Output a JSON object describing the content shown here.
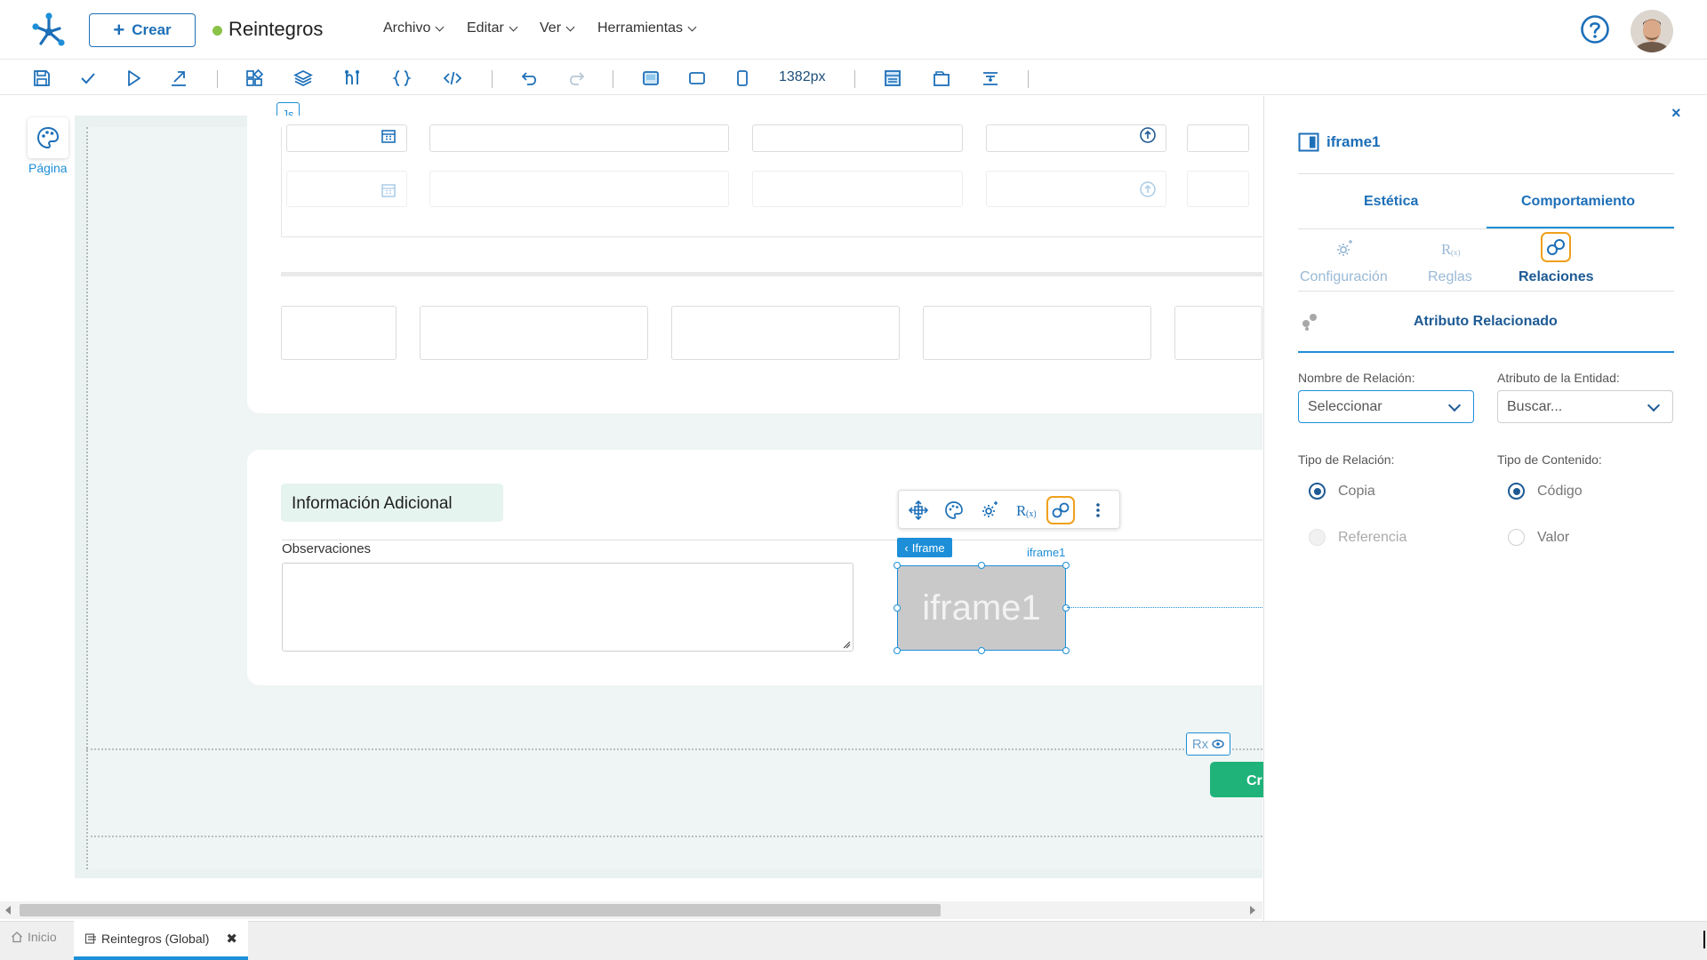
{
  "header": {
    "create_label": "Crear",
    "app_title": "Reintegros",
    "status_color": "#8bc34a",
    "menu": [
      {
        "label": "Archivo"
      },
      {
        "label": "Editar"
      },
      {
        "label": "Ver"
      },
      {
        "label": "Herramientas"
      }
    ],
    "help_icon": "help-circle-icon",
    "avatar": "user-avatar"
  },
  "toolbar": {
    "icons": [
      "save-icon",
      "check-icon",
      "play-icon",
      "publish-icon",
      "components-icon",
      "layers-icon",
      "flow-icon",
      "braces-icon",
      "code-icon",
      "undo-icon",
      "redo-icon",
      "desktop-icon",
      "tablet-icon",
      "mobile-icon",
      "layout-icon",
      "frame-icon",
      "align-icon"
    ],
    "width_readout": "1382px"
  },
  "canvas": {
    "pagina_label": "Página",
    "js_badge": "Js",
    "section_title": "Información Adicional",
    "observaciones_label": "Observaciones",
    "iframe_tag": "Iframe",
    "iframe_name": "iframe1",
    "iframe_placeholder": "iframe1",
    "rx_badge": "Rx",
    "green_button_label": "Cr"
  },
  "bottom_tabs": {
    "home_label": "Inicio",
    "active_tab_label": "Reintegros (Global)"
  },
  "panel": {
    "title": "iframe1",
    "tabs": [
      {
        "label": "Estética"
      },
      {
        "label": "Comportamiento"
      }
    ],
    "subtabs": [
      {
        "label": "Configuración"
      },
      {
        "label": "Reglas"
      },
      {
        "label": "Relaciones"
      }
    ],
    "section_title": "Atributo Relacionado",
    "nombre_relacion_label": "Nombre de Relación:",
    "nombre_relacion_value": "Seleccionar",
    "atributo_entidad_label": "Atributo de la Entidad:",
    "atributo_entidad_placeholder": "Buscar...",
    "tipo_relacion_label": "Tipo de Relación:",
    "tipo_relacion_options": [
      "Copia",
      "Referencia"
    ],
    "tipo_contenido_label": "Tipo de Contenido:",
    "tipo_contenido_options": [
      "Código",
      "Valor"
    ],
    "accent_color": "#1d6fb8",
    "highlight_color": "#f0a01c"
  }
}
